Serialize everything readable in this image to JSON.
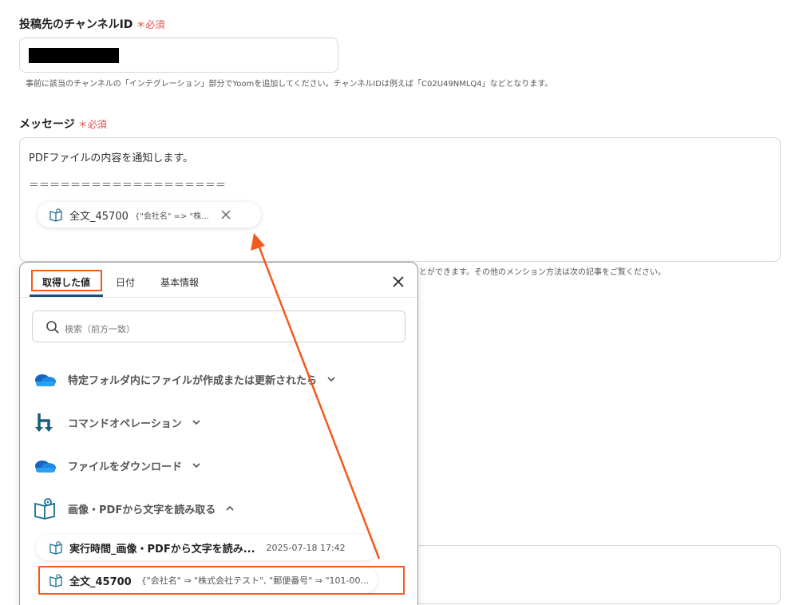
{
  "channel": {
    "label": "投稿先のチャンネルID",
    "required": "＊必須",
    "hint": "事前に該当のチャンネルの「インテグレーション」部分でYoomを追加してください。チャンネルIDは例えば「C02U49NMLQ4」などとなります。"
  },
  "message": {
    "label": "メッセージ",
    "required": "＊必須",
    "line1": "PDFファイルの内容を通知します。",
    "line2": "＝＝＝＝＝＝＝＝＝＝＝＝＝＝＝＝＝＝＝",
    "chip": {
      "name": "全文_45700",
      "preview": "{\"会社名\" => \"株..."
    }
  },
  "behind_hint": "とができます。その他のメンション方法は次の記事をご覧ください。",
  "panel": {
    "tabs": [
      "取得した値",
      "日付",
      "基本情報"
    ],
    "search_placeholder": "検索（前方一致）",
    "steps": [
      {
        "label": "特定フォルダ内にファイルが作成または更新されたら",
        "icon": "onedrive-cloud-icon"
      },
      {
        "label": "コマンドオペレーション",
        "icon": "branch-arrows-icon"
      },
      {
        "label": "ファイルをダウンロード",
        "icon": "onedrive-cloud-icon"
      },
      {
        "label": "画像・PDFから文字を読み取る",
        "icon": "ocr-book-icon"
      }
    ],
    "outputs": [
      {
        "name": "実行時間_画像・PDFから文字を読み...",
        "value": "2025-07-18 17:42"
      },
      {
        "name": "全文_45700",
        "value": "{\"会社名\" ⇒ \"株式会社テスト\", \"郵便番号\" ⇒ \"101-00..."
      }
    ]
  },
  "colors": {
    "accent": "#f25a1d",
    "tab_underline": "#1b4f72",
    "required": "#e24a4a",
    "onedrive": "#1e88e5"
  }
}
